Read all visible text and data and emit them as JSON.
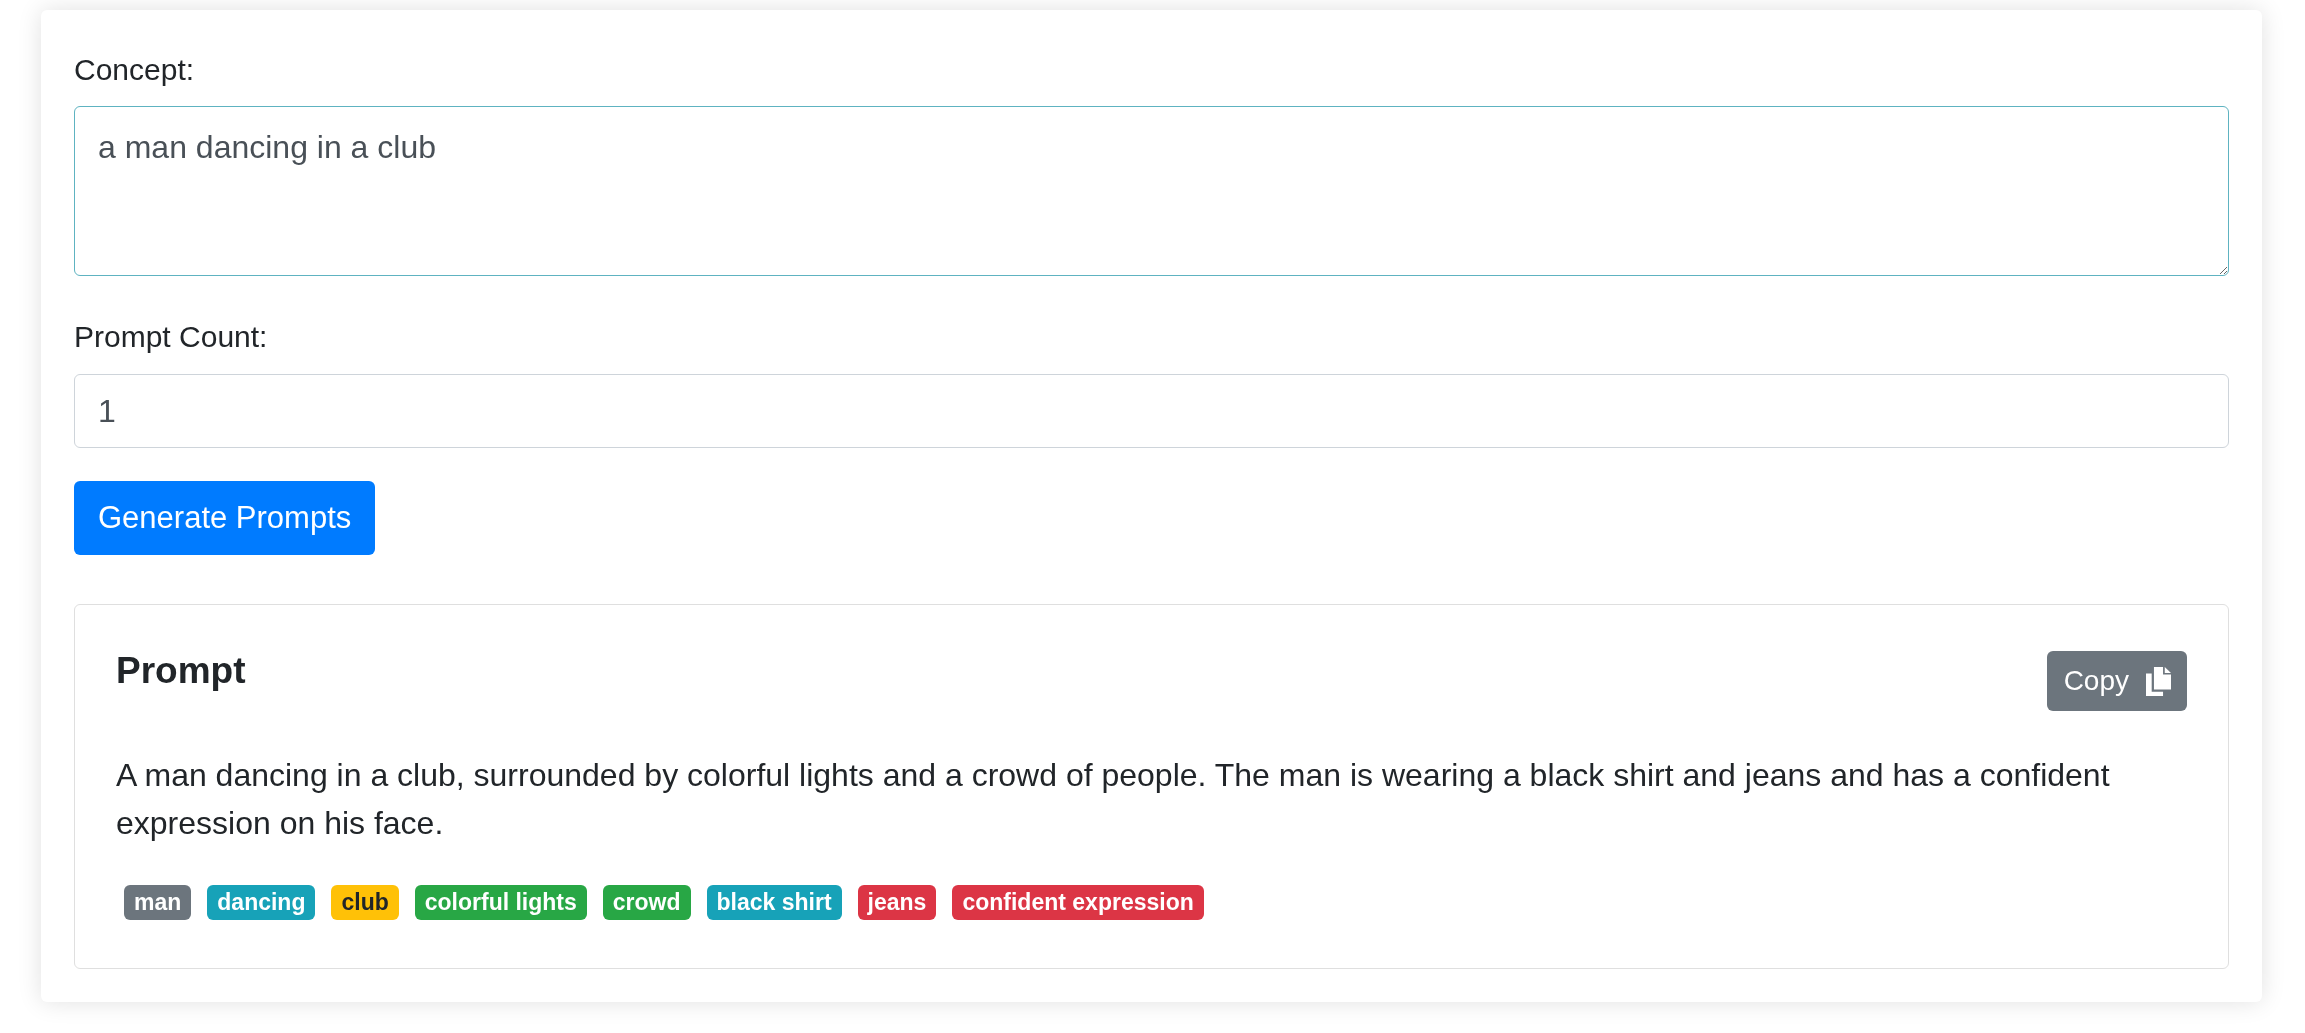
{
  "concept": {
    "label": "Concept:",
    "value": "a man dancing in a club",
    "focused": true
  },
  "prompt_count": {
    "label": "Prompt Count:",
    "value": "1"
  },
  "generate_button": {
    "label": "Generate Prompts"
  },
  "prompt_cards": [
    {
      "title": "Prompt",
      "copy_button": {
        "label": "Copy"
      },
      "text": "A man dancing in a club, surrounded by colorful lights and a crowd of people. The man is wearing a black shirt and jeans and has a confident expression on his face.",
      "tags": [
        {
          "label": "man",
          "color": "#6c757d"
        },
        {
          "label": "dancing",
          "color": "#17a2b8"
        },
        {
          "label": "club",
          "color": "#ffc107"
        },
        {
          "label": "colorful lights",
          "color": "#28a745"
        },
        {
          "label": "crowd",
          "color": "#28a745"
        },
        {
          "label": "black shirt",
          "color": "#17a2b8"
        },
        {
          "label": "jeans",
          "color": "#dc3545"
        },
        {
          "label": "confident expression",
          "color": "#dc3545"
        }
      ]
    }
  ]
}
